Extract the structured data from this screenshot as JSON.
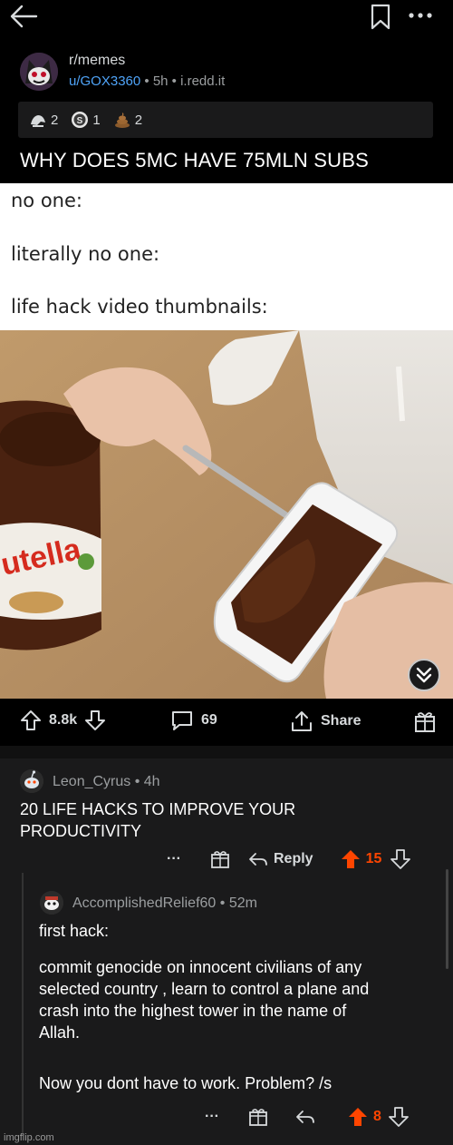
{
  "post": {
    "subreddit": "r/memes",
    "author": "u/GOX3360",
    "time": "5h",
    "domain": "i.redd.it",
    "awards": [
      {
        "icon": "helpful-award-icon",
        "count": "2"
      },
      {
        "icon": "silver-award-icon",
        "count": "1"
      },
      {
        "icon": "poop-award-icon",
        "count": "2"
      }
    ],
    "title": "WHY DOES 5MC HAVE 75MLN SUBS",
    "meme_lines": [
      "no one:",
      "literally no one:",
      "life hack video thumbnails:"
    ],
    "meme_brand_text": "utella",
    "actions": {
      "upvotes": "8.8k",
      "comments": "69",
      "share": "Share"
    }
  },
  "comments": [
    {
      "author": "Leon_Cyrus",
      "time": "4h",
      "body": [
        "20 LIFE HACKS TO IMPROVE YOUR",
        "PRODUCTIVITY"
      ],
      "more": "···",
      "reply": "Reply",
      "score": "15"
    },
    {
      "author": "AccomplishedRelief60",
      "time": "52m",
      "body": [
        "first hack:",
        "commit genocide on innocent civilians of any",
        "selected country , learn to control a plane and",
        "crash into the highest tower in the name of",
        "Allah.",
        "Now you dont have to work. Problem? /s"
      ],
      "more": "···",
      "score": "8"
    }
  ],
  "watermark": "imgflip.com",
  "colors": {
    "background": "#000000",
    "comment_bg": "#1a1a1b",
    "link_blue": "#4fa3f7",
    "upvote_orange": "#ff4500",
    "text": "#d7dadc"
  }
}
